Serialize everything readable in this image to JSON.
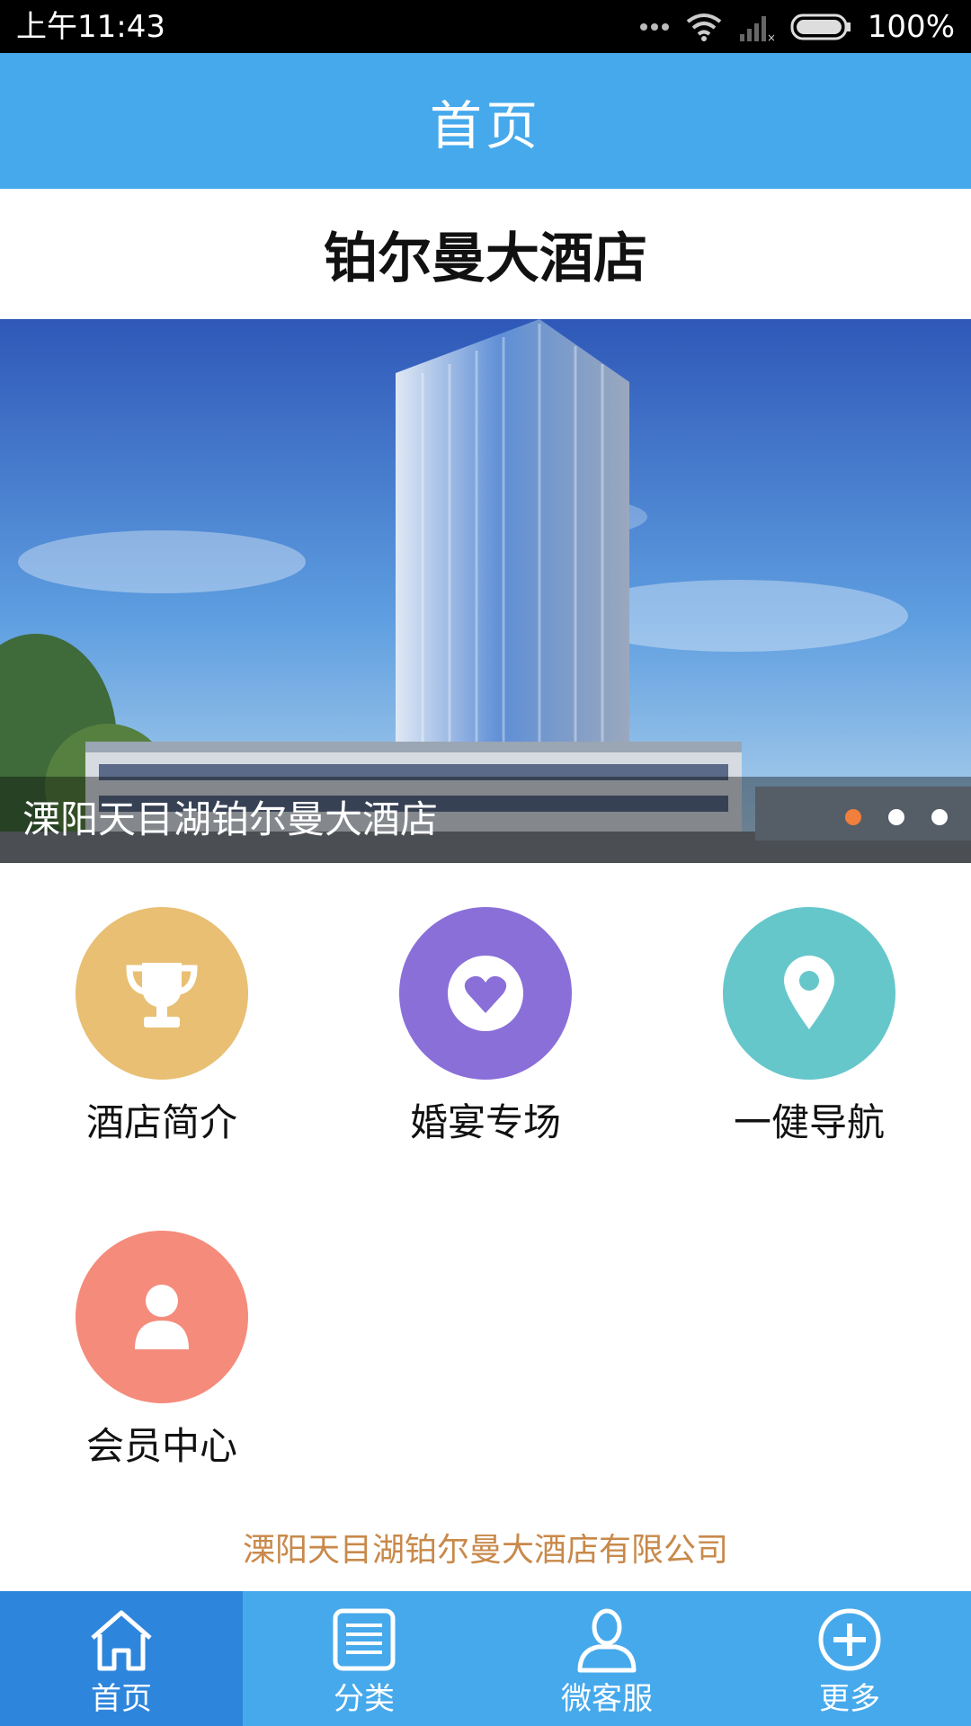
{
  "status_bar": {
    "time": "上午11:43",
    "battery": "100%"
  },
  "nav": {
    "title": "首页"
  },
  "hotel_title": "铂尔曼大酒店",
  "banner": {
    "caption": "溧阳天目湖铂尔曼大酒店",
    "slide_count": 3,
    "active_slide": 1
  },
  "menu": [
    {
      "label": "酒店简介",
      "icon": "trophy-icon",
      "color": "#e8bf73"
    },
    {
      "label": "婚宴专场",
      "icon": "heart-icon",
      "color": "#8a6fd9"
    },
    {
      "label": "一健导航",
      "icon": "location-pin-icon",
      "color": "#66c7cb"
    },
    {
      "label": "会员中心",
      "icon": "person-icon",
      "color": "#f58b7b"
    }
  ],
  "company": "溧阳天目湖铂尔曼大酒店有限公司",
  "tabs": [
    {
      "label": "首页",
      "icon": "home-icon",
      "active": true
    },
    {
      "label": "分类",
      "icon": "list-icon",
      "active": false
    },
    {
      "label": "微客服",
      "icon": "user-icon",
      "active": false
    },
    {
      "label": "更多",
      "icon": "plus-circle-icon",
      "active": false
    }
  ],
  "colors": {
    "primary": "#46a9ec",
    "active_tab": "#2e86dc",
    "company_text": "#c8894a",
    "active_dot": "#f0803c"
  }
}
